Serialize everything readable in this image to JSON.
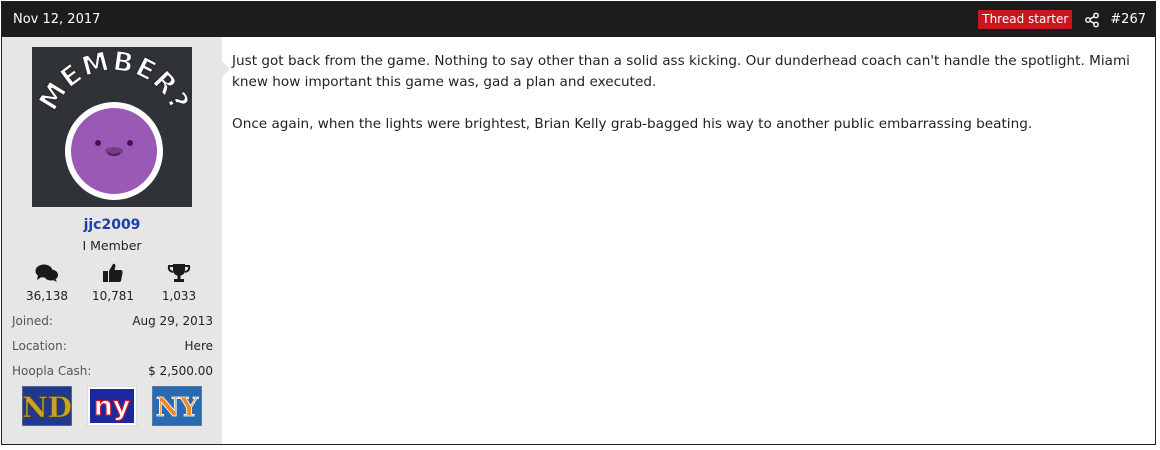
{
  "header": {
    "date": "Nov 12, 2017",
    "thread_starter": "Thread starter",
    "post_number": "#267",
    "badge_color": "#c9151d"
  },
  "user": {
    "avatar_text": "MEMBER?",
    "username": "jjc2009",
    "title": "I Member",
    "stats": [
      {
        "icon": "messages-icon",
        "value": "36,138"
      },
      {
        "icon": "thumbs-up-icon",
        "value": "10,781"
      },
      {
        "icon": "trophy-icon",
        "value": "1,033"
      }
    ],
    "info": [
      {
        "label": "Joined:",
        "value": "Aug 29, 2013"
      },
      {
        "label": "Location:",
        "value": "Here"
      },
      {
        "label": "Hoopla Cash:",
        "value": "$ 2,500.00"
      }
    ],
    "team_logos": [
      {
        "name": "notre-dame-logo",
        "text": "ND"
      },
      {
        "name": "new-york-giants-logo",
        "text": "ny"
      },
      {
        "name": "new-york-mets-logo",
        "text": "NY"
      }
    ]
  },
  "post": {
    "paragraphs": [
      "Just got back from the game. Nothing to say other than a solid ass kicking. Our dunderhead coach can't handle the spotlight. Miami knew how important this game was, gad a plan and executed.",
      "Once again, when the lights were brightest, Brian Kelly grab-bagged his way to another public embarrassing beating."
    ]
  }
}
